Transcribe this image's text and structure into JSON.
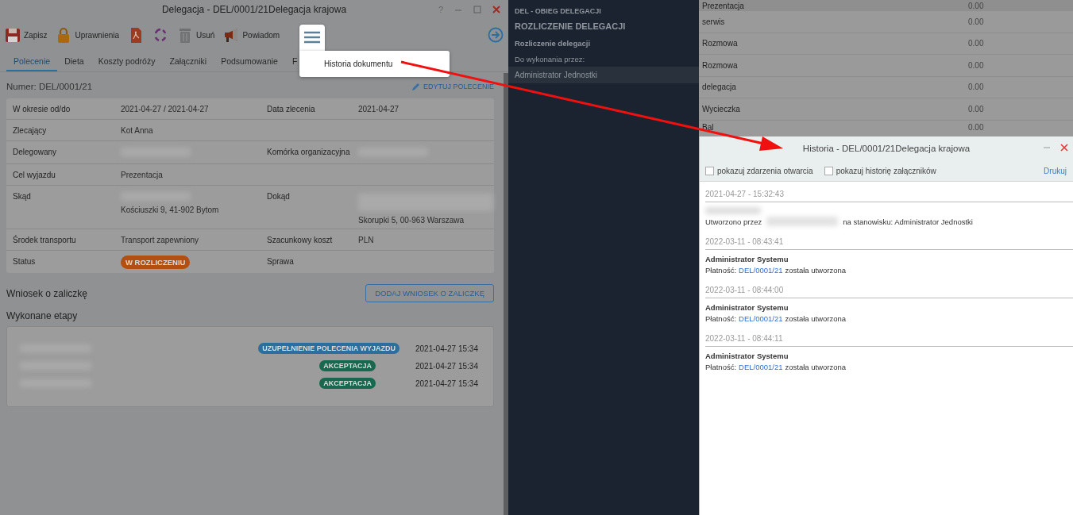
{
  "window": {
    "title": "Delegacja - DEL/0001/21Delegacja krajowa",
    "help": "?"
  },
  "toolbar": [
    {
      "kind": "save",
      "label": "Zapisz"
    },
    {
      "kind": "lock",
      "label": "Uprawnienia"
    },
    {
      "kind": "pdf"
    },
    {
      "kind": "cycle"
    },
    {
      "kind": "trash",
      "label": "Usuń"
    },
    {
      "kind": "megaphone",
      "label": "Powiadom"
    },
    {
      "kind": "menu",
      "expanded": true
    }
  ],
  "menu": {
    "items": [
      "Historia dokumentu"
    ]
  },
  "tabs": [
    {
      "label": "Polecenie",
      "selected": true
    },
    {
      "label": "Dieta",
      "selected": false
    },
    {
      "label": "Koszty podróży",
      "selected": false
    },
    {
      "label": "Załączniki",
      "selected": false
    },
    {
      "label": "Podsumowanie",
      "selected": false
    },
    {
      "label": "F",
      "selected": false
    }
  ],
  "number": "Numer: DEL/0001/21",
  "edit_button": "EDYTUJ POLECENIE",
  "details": [
    {
      "left": {
        "label": "W okresie od/do",
        "value": "2021-04-27 / 2021-04-27"
      },
      "right": {
        "label": "Data zlecenia",
        "value": "2021-04-27"
      }
    },
    {
      "left": {
        "label": "Zlecający",
        "value": "Kot Anna"
      }
    },
    {
      "left": {
        "label": "Delegowany",
        "redacted": true
      },
      "right": {
        "label": "Komórka organizacyjna",
        "redacted": true
      }
    },
    {
      "left": {
        "label": "Cel wyjazdu",
        "value": "Prezentacja"
      }
    },
    {
      "left": {
        "label": "Skąd",
        "redacted": true,
        "value": "Kościuszki 9, 41-902 Bytom"
      },
      "right": {
        "label": "Dokąd",
        "redacted": true,
        "redacted_block": true,
        "value": "Skorupki 5, 00-963 Warszawa"
      }
    },
    {
      "left": {
        "label": "Środek transportu",
        "value": "Transport zapewniony"
      },
      "right": {
        "label": "Szacunkowy koszt",
        "value": "PLN"
      }
    },
    {
      "left": {
        "label": "Status",
        "badge": "W ROZLICZENIU",
        "color": "#b3500f"
      },
      "right": {
        "label": "Sprawa"
      }
    }
  ],
  "advance": {
    "title": "Wniosek o zaliczkę",
    "button": "DODAJ WNIOSEK O ZALICZKĘ"
  },
  "stages": {
    "title": "Wykonane etapy",
    "items": [
      {
        "badge": "UZUPEŁNIENIE POLECENIA WYJAZDU",
        "color": "#2a6f9e",
        "date": "2021-04-27 15:34"
      },
      {
        "badge": "AKCEPTACJA",
        "color": "#17684e",
        "date": "2021-04-27 15:34"
      },
      {
        "badge": "AKCEPTACJA",
        "color": "#17684e",
        "date": "2021-04-27 15:34"
      }
    ]
  },
  "workflow": {
    "process": "DEL - OBIEG DELEGACJI",
    "stage": "ROZLICZENIE DELEGACJI",
    "step": "Rozliczenie delegacji",
    "assignee_label": "Do wykonania przez:",
    "assignees": [
      {
        "name": "Administrator Jednostki",
        "selected": true
      }
    ]
  },
  "background_list": [
    {
      "name": "Prezentacja",
      "value": "0.00"
    },
    {
      "name": "serwis",
      "value": "0.00"
    },
    {
      "name": "Rozmowa",
      "value": "0.00"
    },
    {
      "name": "Rozmowa",
      "value": "0.00"
    },
    {
      "name": "delegacja",
      "value": "0.00"
    },
    {
      "name": "Wycieczka",
      "value": "0.00"
    },
    {
      "name": "Bal",
      "value": "0.00"
    }
  ],
  "history": {
    "title": "Historia - DEL/0001/21Delegacja krajowa",
    "options": [
      {
        "label": "pokazuj zdarzenia otwarcia",
        "checked": false
      },
      {
        "label": "pokazuj historię załączników",
        "checked": false
      }
    ],
    "print": "Drukuj",
    "entries": [
      {
        "date": "2021-04-27 - 15:32:43",
        "author_redacted": true,
        "prefix": "Utworzono przez",
        "actor_redacted": true,
        "suffix": "na stanowisku: Administrator Jednostki"
      },
      {
        "date": "2022-03-11 - 08:43:41",
        "author": "Administrator Systemu",
        "prefix": "Płatność:",
        "link": "DEL/0001/21",
        "suffix": "została utworzona"
      },
      {
        "date": "2022-03-11 - 08:44:00",
        "author": "Administrator Systemu",
        "prefix": "Płatność:",
        "link": "DEL/0001/21",
        "suffix": "została utworzona"
      },
      {
        "date": "2022-03-11 - 08:44:11",
        "author": "Administrator Systemu",
        "prefix": "Płatność:",
        "link": "DEL/0001/21",
        "suffix": "została utworzona"
      }
    ]
  }
}
